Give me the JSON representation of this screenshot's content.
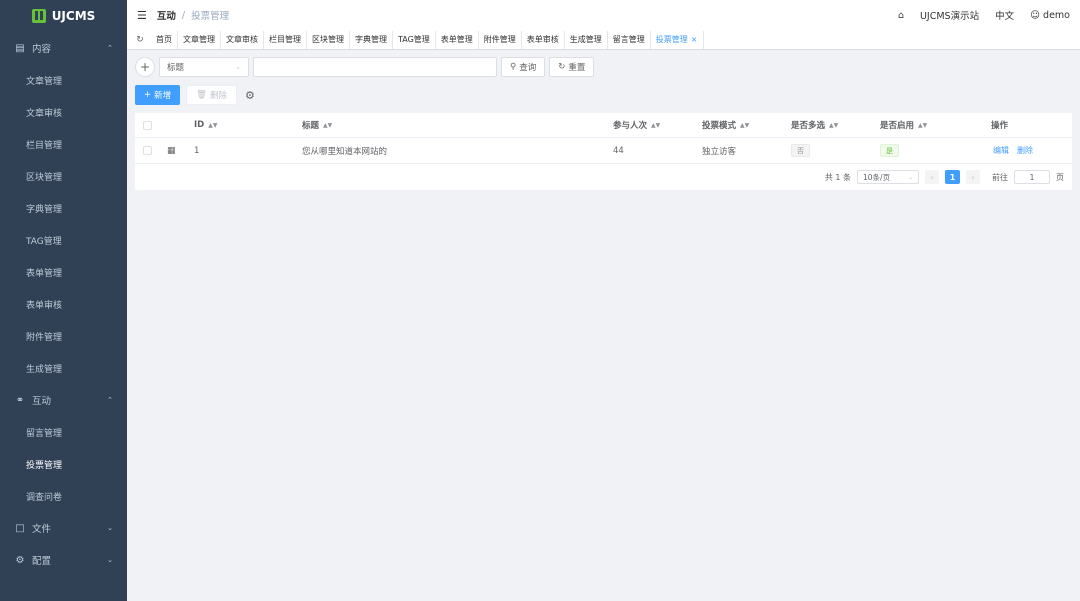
{
  "app": {
    "name": "UJCMS"
  },
  "sidebar": {
    "groups": [
      {
        "label": "内容",
        "icon": "document-icon",
        "expanded": true,
        "items": [
          "文章管理",
          "文章审核",
          "栏目管理",
          "区块管理",
          "字典管理",
          "TAG管理",
          "表单管理",
          "表单审核",
          "附件管理",
          "生成管理"
        ]
      },
      {
        "label": "互动",
        "icon": "chat-icon",
        "expanded": true,
        "items": [
          "留言管理",
          "投票管理",
          "调查问卷"
        ]
      },
      {
        "label": "文件",
        "icon": "folder-icon",
        "expanded": false,
        "items": []
      },
      {
        "label": "配置",
        "icon": "gear-icon",
        "expanded": false,
        "items": []
      }
    ],
    "active_item": "投票管理"
  },
  "header": {
    "breadcrumb": [
      "互动",
      "投票管理"
    ],
    "site": "UJCMS演示站",
    "language": "中文",
    "user": "demo"
  },
  "tabs": [
    "首页",
    "文章管理",
    "文章审核",
    "栏目管理",
    "区块管理",
    "字典管理",
    "TAG管理",
    "表单管理",
    "附件管理",
    "表单审核",
    "生成管理",
    "留言管理",
    "投票管理"
  ],
  "active_tab": "投票管理",
  "search": {
    "field": "标题",
    "value": "",
    "query_label": "查询",
    "reset_label": "重置"
  },
  "actions": {
    "add_label": "新增",
    "delete_label": "删除"
  },
  "table": {
    "columns": [
      "ID",
      "标题",
      "参与人次",
      "投票模式",
      "是否多选",
      "是否启用",
      "操作"
    ],
    "rows": [
      {
        "id": "1",
        "title": "您从哪里知道本网站的",
        "count": "44",
        "mode": "独立访客",
        "multi": "否",
        "enabled": "是",
        "edit": "编辑",
        "delete": "删除"
      }
    ]
  },
  "pagination": {
    "total_text": "共 1 条",
    "page_size": "10条/页",
    "current_page": "1",
    "goto_label": "前往",
    "goto_value": "1",
    "page_unit": "页"
  },
  "colors": {
    "sidebar_bg": "#304156",
    "primary": "#409eff",
    "success": "#67c23a"
  }
}
